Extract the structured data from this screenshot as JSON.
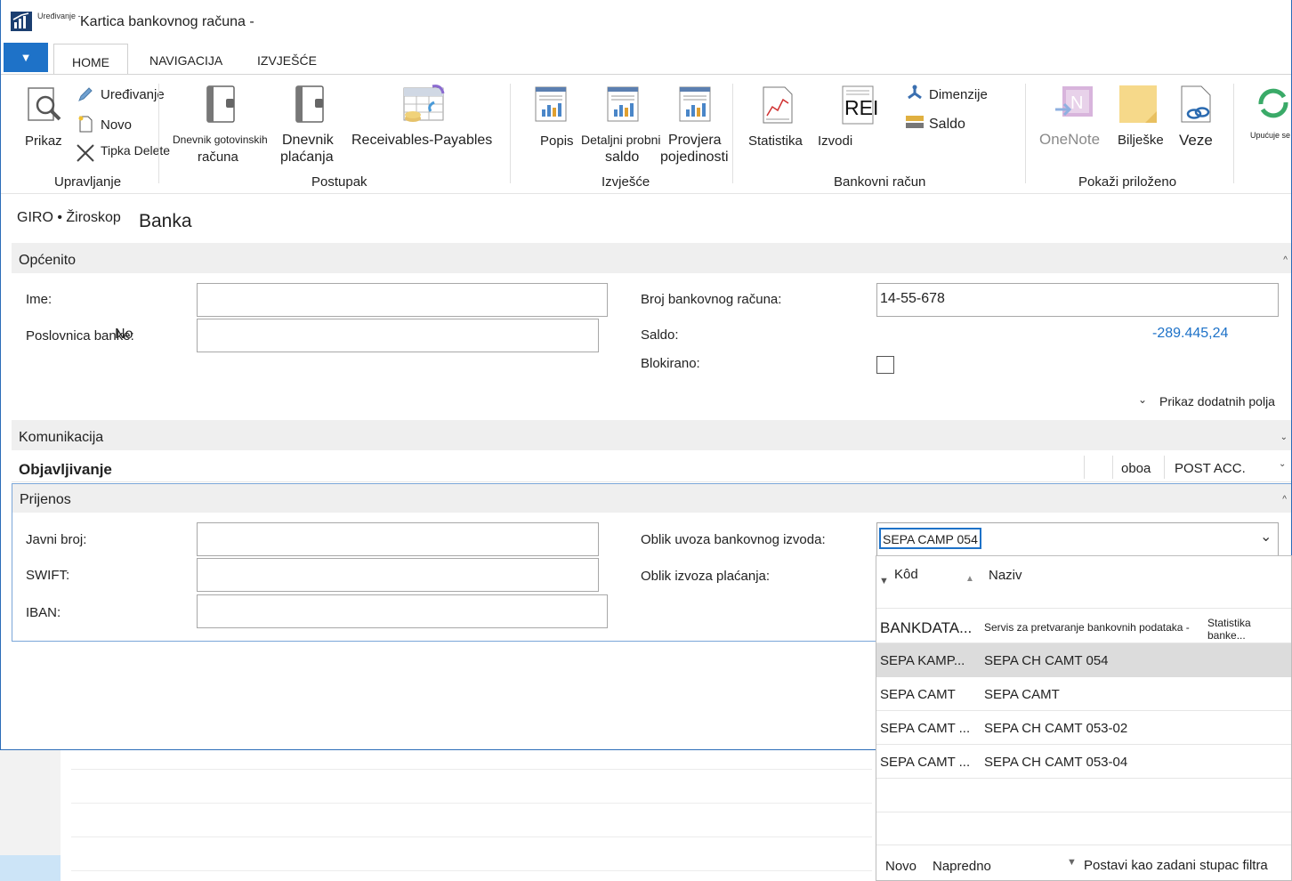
{
  "window": {
    "sub_label": "Uređivanje -",
    "title": "Kartica bankovnog računa -"
  },
  "tabs": [
    {
      "label": "HOME"
    },
    {
      "label": "NAVIGACIJA"
    },
    {
      "label": "IZVJEŠĆE"
    }
  ],
  "ribbon": {
    "groups": {
      "upravljanje": "Upravljanje",
      "postupak": "Postupak",
      "izvjesce": "Izvješće",
      "bankovni_racun": "Bankovni račun",
      "prilozeno": "Pokaži priloženo"
    },
    "prikaz": "Prikaz",
    "uredivanje": "Uređivanje",
    "novo": "Novo",
    "tipka_delete": "Tipka Delete",
    "dnevnik_got_1": "Dnevnik gotovinskih",
    "dnevnik_got_2": "računa",
    "dnevnik_pl_1": "Dnevnik",
    "dnevnik_pl_2": "plaćanja",
    "receivables": "Receivables-Payables",
    "popis": "Popis",
    "detaljni_1": "Detaljni probni",
    "detaljni_2": "saldo",
    "provjera_1": "Provjera",
    "provjera_2": "pojedinosti",
    "statistika": "Statistika",
    "izvodi": "Izvodi",
    "izvodi_icon_text": "REI",
    "dimenzije": "Dimenzije",
    "saldo": "Saldo",
    "onenote": "OneNote",
    "biljeske": "Bilješke",
    "veze": "Veze",
    "upucuje": "Upućuje se"
  },
  "breadcrumb": "GIRO • Žiroskop",
  "page_title": "Banka",
  "sections": {
    "opcenito": "Općenito",
    "komunikacija": "Komunikacija",
    "objavljivanje": "Objavljivanje",
    "objavljivanje_col1": "oboa",
    "objavljivanje_col2": "POST ACC.",
    "prijenos": "Prijenos"
  },
  "opcenito": {
    "ime_label": "Ime:",
    "ime_value": "",
    "poslovnica_label": "Poslovnica banke:",
    "poslovnica_overlay": "No",
    "poslovnica_value": "",
    "broj_label": "Broj bankovnog računa:",
    "broj_value": "14-55-678",
    "saldo_label": "Saldo:",
    "saldo_value": "-289.445,24",
    "blokirano_label": "Blokirano:",
    "blokirano_checked": false,
    "more_fields": "Prikaz dodatnih polja"
  },
  "prijenos": {
    "javni_broj_label": "Javni broj:",
    "swift_label": "SWIFT:",
    "iban_label": "IBAN:",
    "oblik_uvoza_label": "Oblik uvoza bankovnog izvoda:",
    "oblik_uvoza_value": "SEPA CAMP 054",
    "oblik_izvoza_label": "Oblik izvoza plaćanja:"
  },
  "dropdown": {
    "col_code": "Kôd",
    "col_name": "Naziv",
    "rows": [
      {
        "code": "BANKDATA...",
        "name": "Servis za pretvaranje bankovnih podataka -",
        "extra": "Statistika banke..."
      },
      {
        "code": "SEPA KAMP...",
        "name": "SEPA CH CAMT 054"
      },
      {
        "code": "SEPA CAMT",
        "name": "SEPA CAMT"
      },
      {
        "code": "SEPA CAMT ...",
        "name": "SEPA CH CAMT 053-02"
      },
      {
        "code": "SEPA CAMT ...",
        "name": "SEPA CH CAMT 053-04"
      }
    ],
    "footer": {
      "novo": "Novo",
      "napredno": "Napredno",
      "default_filter": "Postavi kao zadani stupac filtra"
    }
  },
  "colors": {
    "accent": "#1e72c8",
    "link_value": "#1e72c8",
    "selected_row": "#dcdcdc"
  }
}
